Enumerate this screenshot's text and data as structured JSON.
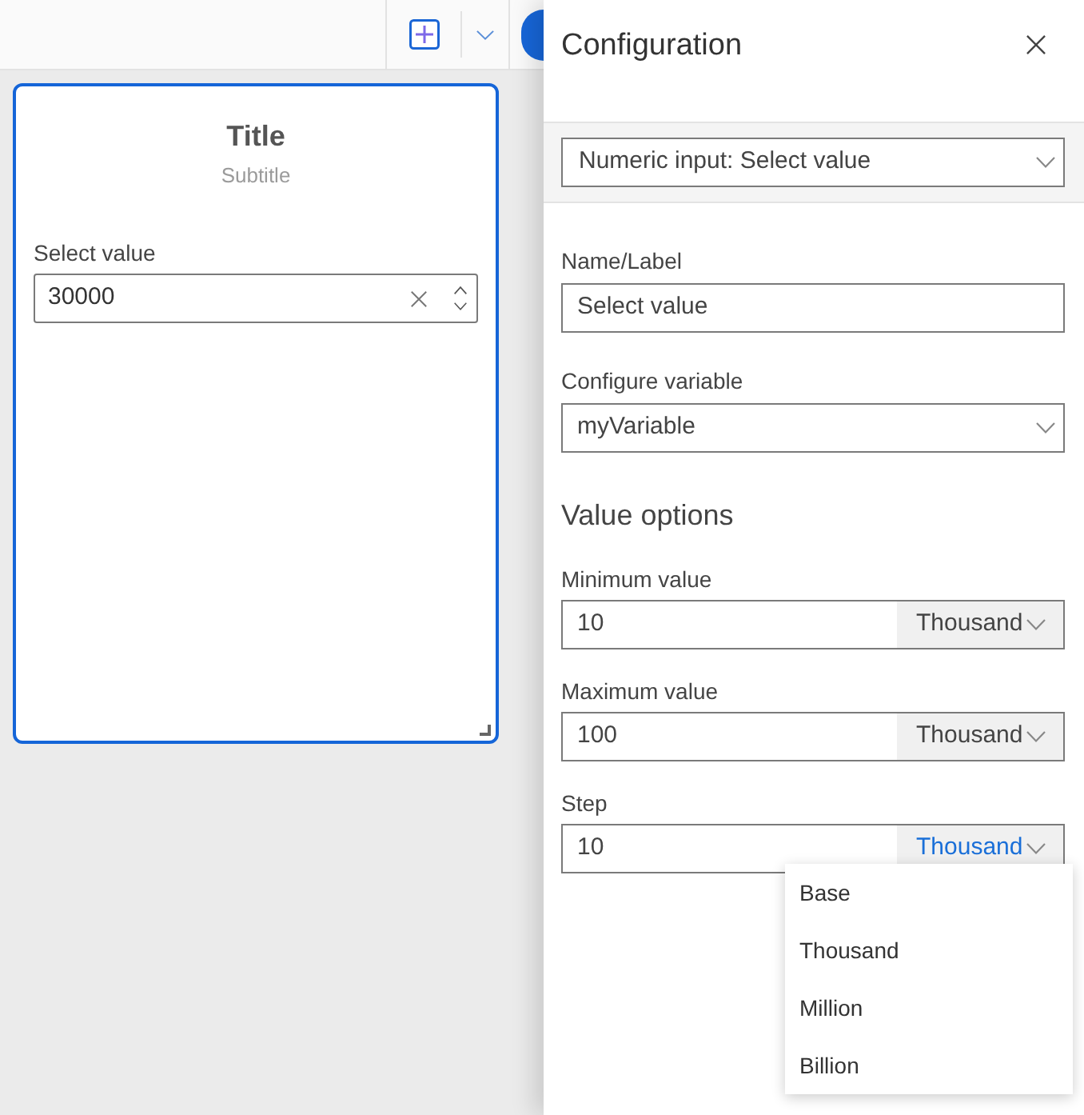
{
  "card": {
    "selected": true,
    "title": "Title",
    "subtitle": "Subtitle",
    "field": {
      "label": "Select value",
      "value": "30000"
    }
  },
  "panel": {
    "title": "Configuration",
    "component_select": {
      "value": "Numeric input: Select value"
    },
    "name_field": {
      "label": "Name/Label",
      "value": "Select value"
    },
    "variable_select": {
      "label": "Configure variable",
      "value": "myVariable"
    },
    "value_options": {
      "heading": "Value options",
      "fields": [
        {
          "label": "Minimum value",
          "value": "10",
          "unit": "Thousand",
          "open": false
        },
        {
          "label": "Maximum value",
          "value": "100",
          "unit": "Thousand",
          "open": false
        },
        {
          "label": "Step",
          "value": "10",
          "unit": "Thousand",
          "open": true
        }
      ]
    },
    "unit_menu": {
      "items": [
        "Base",
        "Thousand",
        "Million",
        "Billion"
      ]
    }
  }
}
